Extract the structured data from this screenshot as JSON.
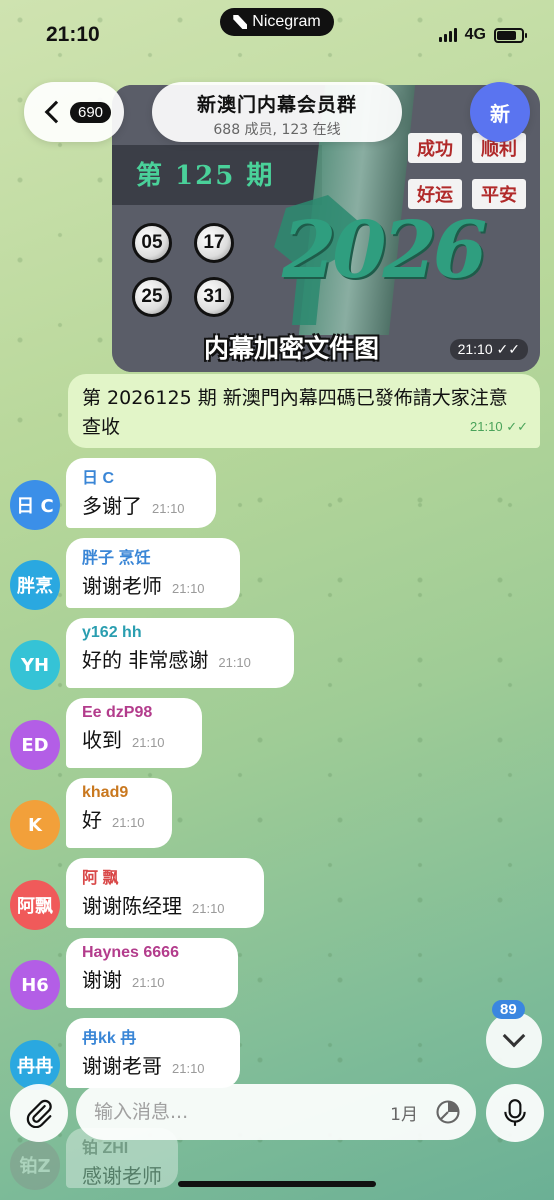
{
  "status_bar": {
    "time": "21:10",
    "island_label": "Nicegram",
    "network": "4G",
    "battery_level": 0.8
  },
  "header": {
    "back_count": "690",
    "title": "新澳门内幕会员群",
    "subtitle": "688 成员, 123 在线",
    "avatar_text": "新",
    "avatar_color": "#5a74f0"
  },
  "image_message": {
    "issue_label": "第 125 期",
    "numbers": [
      "05",
      "17",
      "25",
      "31"
    ],
    "tags": [
      "成功",
      "顺利",
      "好运",
      "平安"
    ],
    "year_art": "2026",
    "caption": "内幕加密文件图",
    "time": "21:10"
  },
  "outgoing_message": {
    "text": "第 2026125 期 新澳門內幕四碼已發佈請大家注意查收",
    "time": "21:10"
  },
  "messages": [
    {
      "avatar": "日 C",
      "avatar_color": "#3b8fe8",
      "sender": "日 C",
      "sender_color": "#3a86d6",
      "text": "多谢了",
      "time": "21:10"
    },
    {
      "avatar": "胖烹",
      "avatar_color": "#2aa8e0",
      "sender": "胖子 烹饪",
      "sender_color": "#3a86d6",
      "text": "谢谢老师",
      "time": "21:10"
    },
    {
      "avatar": "YH",
      "avatar_color": "#35c3d6",
      "sender": "y162 hh",
      "sender_color": "#2a9eb0",
      "text": "好的 非常感谢",
      "time": "21:10"
    },
    {
      "avatar": "ED",
      "avatar_color": "#b35ee6",
      "sender": "Ee dzP98",
      "sender_color": "#b33c8c",
      "text": "收到",
      "time": "21:10"
    },
    {
      "avatar": "K",
      "avatar_color": "#f2a03a",
      "sender": "khad9",
      "sender_color": "#c9781f",
      "text": "好",
      "time": "21:10"
    },
    {
      "avatar": "阿飘",
      "avatar_color": "#f05a5a",
      "sender": "阿 飘",
      "sender_color": "#d94848",
      "text": "谢谢陈经理",
      "time": "21:10"
    },
    {
      "avatar": "H6",
      "avatar_color": "#b35ee6",
      "sender": "Haynes 6666",
      "sender_color": "#b33c8c",
      "text": "谢谢",
      "time": "21:10"
    },
    {
      "avatar": "冉冉",
      "avatar_color": "#2aa8e0",
      "sender": "冉kk 冉",
      "sender_color": "#3a86d6",
      "text": "谢谢老哥",
      "time": "21:10"
    }
  ],
  "faded_message": {
    "avatar": "铂Z",
    "sender": "铂 ZHI",
    "text": "感谢老师"
  },
  "composer": {
    "placeholder": "输入消息...",
    "month_label": "1月"
  },
  "scroll_badge": "89"
}
